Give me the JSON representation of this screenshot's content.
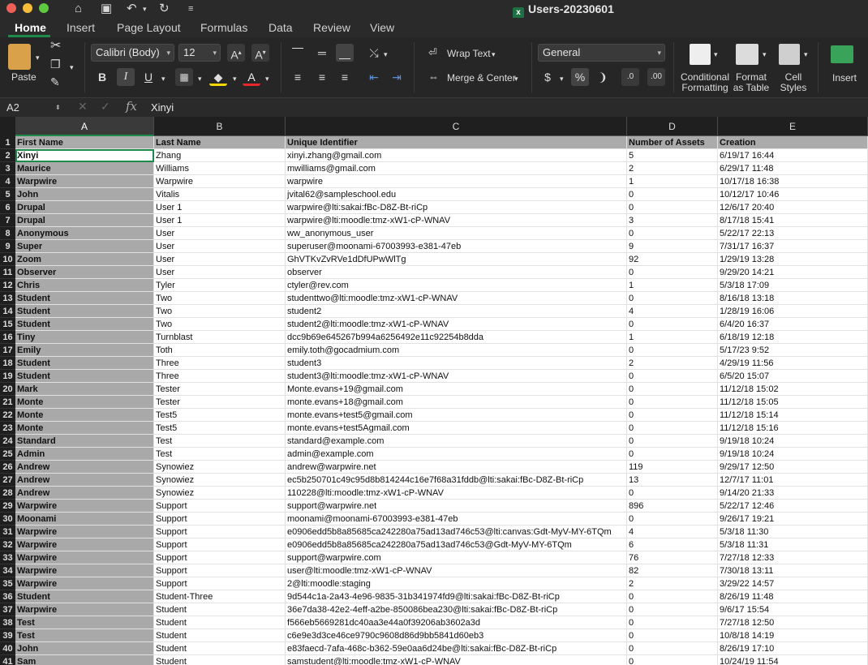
{
  "window": {
    "title": "Users-20230601"
  },
  "tabs": [
    "Home",
    "Insert",
    "Page Layout",
    "Formulas",
    "Data",
    "Review",
    "View"
  ],
  "ribbon": {
    "paste": "Paste",
    "font_name": "Calibri (Body)",
    "font_size": "12",
    "wrap_text": "Wrap Text",
    "merge_center": "Merge & Center",
    "number_format": "General",
    "conditional_formatting": [
      "Conditional",
      "Formatting"
    ],
    "format_as_table": [
      "Format",
      "as Table"
    ],
    "cell_styles": [
      "Cell",
      "Styles"
    ],
    "insert": "Insert",
    "bold": "B",
    "italic": "I",
    "underline": "U"
  },
  "formula_bar": {
    "cell_ref": "A2",
    "fx": "fx",
    "content": "Xinyi"
  },
  "columns": [
    "A",
    "B",
    "C",
    "D",
    "E"
  ],
  "headers": [
    "First Name",
    "Last Name",
    "Unique Identifier",
    "Number of Assets",
    "Creation"
  ],
  "rows": [
    [
      "Xinyi",
      "Zhang",
      "xinyi.zhang@gmail.com",
      "5",
      "6/19/17 16:44"
    ],
    [
      "Maurice",
      "Williams",
      "mwilliams@gmail.com",
      "2",
      "6/29/17 11:48"
    ],
    [
      "Warpwire",
      "Warpwire",
      "warpwire",
      "1",
      "10/17/18 16:38"
    ],
    [
      "John",
      "Vitalis",
      "jvital62@sampleschool.edu",
      "0",
      "10/12/17 10:46"
    ],
    [
      "Drupal",
      "User 1",
      "warpwire@lti:sakai:fBc-D8Z-Bt-riCp",
      "0",
      "12/6/17 20:40"
    ],
    [
      "Drupal",
      "User 1",
      "warpwire@lti:moodle:tmz-xW1-cP-WNAV",
      "3",
      "8/17/18 15:41"
    ],
    [
      "Anonymous",
      "User",
      "ww_anonymous_user",
      "0",
      "5/22/17 22:13"
    ],
    [
      "Super",
      "User",
      "superuser@moonami-67003993-e381-47eb",
      "9",
      "7/31/17 16:37"
    ],
    [
      "Zoom",
      "User",
      "GhVTKvZvRVe1dDfUPwWlTg",
      "92",
      "1/29/19 13:28"
    ],
    [
      "Observer",
      "User",
      "observer",
      "0",
      "9/29/20 14:21"
    ],
    [
      "Chris",
      "Tyler",
      "ctyler@rev.com",
      "1",
      "5/3/18 17:09"
    ],
    [
      "Student",
      "Two",
      "studenttwo@lti:moodle:tmz-xW1-cP-WNAV",
      "0",
      "8/16/18 13:18"
    ],
    [
      "Student",
      "Two",
      "student2",
      "4",
      "1/28/19 16:06"
    ],
    [
      "Student",
      "Two",
      "student2@lti:moodle:tmz-xW1-cP-WNAV",
      "0",
      "6/4/20 16:37"
    ],
    [
      "Tiny",
      "Turnblast",
      "dcc9b69e645267b994a6256492e11c92254b8dda",
      "1",
      "6/18/19 12:18"
    ],
    [
      "Emily",
      "Toth",
      "emily.toth@gocadmium.com",
      "0",
      "5/17/23 9:52"
    ],
    [
      "Student",
      "Three",
      "student3",
      "2",
      "4/29/19 11:56"
    ],
    [
      "Student",
      "Three",
      "student3@lti:moodle:tmz-xW1-cP-WNAV",
      "0",
      "6/5/20 15:07"
    ],
    [
      "Mark",
      "Tester",
      "Monte.evans+19@gmail.com",
      "0",
      "11/12/18 15:02"
    ],
    [
      "Monte",
      "Tester",
      "monte.evans+18@gmail.com",
      "0",
      "11/12/18 15:05"
    ],
    [
      "Monte",
      "Test5",
      "monte.evans+test5@gmail.com",
      "0",
      "11/12/18 15:14"
    ],
    [
      "Monte",
      "Test5",
      "monte.evans+test5Agmail.com",
      "0",
      "11/12/18 15:16"
    ],
    [
      "Standard",
      "Test",
      "standard@example.com",
      "0",
      "9/19/18 10:24"
    ],
    [
      "Admin",
      "Test",
      "admin@example.com",
      "0",
      "9/19/18 10:24"
    ],
    [
      "Andrew",
      "Synowiez",
      "andrew@warpwire.net",
      "119",
      "9/29/17 12:50"
    ],
    [
      "Andrew",
      "Synowiez",
      "ec5b250701c49c95d8b814244c16e7f68a31fddb@lti:sakai:fBc-D8Z-Bt-riCp",
      "13",
      "12/7/17 11:01"
    ],
    [
      "Andrew",
      "Synowiez",
      "110228@lti:moodle:tmz-xW1-cP-WNAV",
      "0",
      "9/14/20 21:33"
    ],
    [
      "Warpwire",
      "Support",
      "support@warpwire.net",
      "896",
      "5/22/17 12:46"
    ],
    [
      "Moonami",
      "Support",
      "moonami@moonami-67003993-e381-47eb",
      "0",
      "9/26/17 19:21"
    ],
    [
      "Warpwire",
      "Support",
      "e0906edd5b8a85685ca242280a75ad13ad746c53@lti:canvas:Gdt-MyV-MY-6TQm",
      "4",
      "5/3/18 11:30"
    ],
    [
      "Warpwire",
      "Support",
      "e0906edd5b8a85685ca242280a75ad13ad746c53@Gdt-MyV-MY-6TQm",
      "6",
      "5/3/18 11:31"
    ],
    [
      "Warpwire",
      "Support",
      "support@warpwire.com",
      "76",
      "7/27/18 12:33"
    ],
    [
      "Warpwire",
      "Support",
      "user@lti:moodle:tmz-xW1-cP-WNAV",
      "82",
      "7/30/18 13:11"
    ],
    [
      "Warpwire",
      "Support",
      "2@lti:moodle:staging",
      "2",
      "3/29/22 14:57"
    ],
    [
      "Student",
      "Student-Three",
      "9d544c1a-2a43-4e96-9835-31b341974fd9@lti:sakai:fBc-D8Z-Bt-riCp",
      "0",
      "8/26/19 11:48"
    ],
    [
      "Warpwire",
      "Student",
      "36e7da38-42e2-4eff-a2be-850086bea230@lti:sakai:fBc-D8Z-Bt-riCp",
      "0",
      "9/6/17 15:54"
    ],
    [
      "Test",
      "Student",
      "f566eb5669281dc40aa3e44a0f39206ab3602a3d",
      "0",
      "7/27/18 12:50"
    ],
    [
      "Test",
      "Student",
      "c6e9e3d3ce46ce9790c9608d86d9bb5841d60eb3",
      "0",
      "10/8/18 14:19"
    ],
    [
      "John",
      "Student",
      "e83faecd-7afa-468c-b362-59e0aa6d24be@lti:sakai:fBc-D8Z-Bt-riCp",
      "0",
      "8/26/19 17:10"
    ],
    [
      "Sam",
      "Student",
      "samstudent@lti:moodle:tmz-xW1-cP-WNAV",
      "0",
      "10/24/19 11:54"
    ]
  ]
}
